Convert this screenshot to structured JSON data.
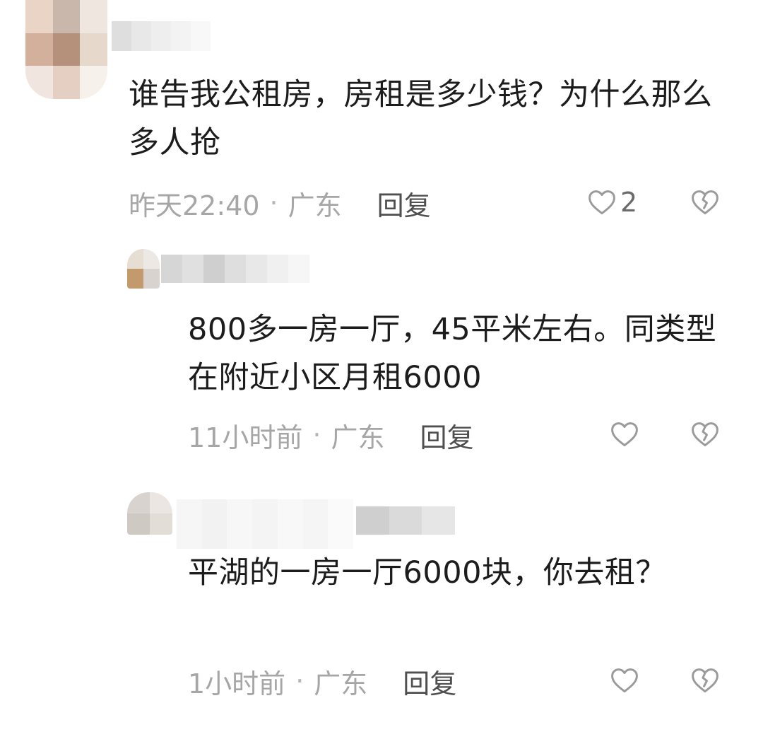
{
  "comment": {
    "text": "谁告我公租房，房租是多少钱？为什么那么多人抢",
    "time": "昨天22:40",
    "location": "广东",
    "separator": "·",
    "reply_label": "回复",
    "like_count": "2",
    "like_icon": "heart-outline-icon",
    "dislike_icon": "broken-heart-icon"
  },
  "replies": [
    {
      "text": "800多一房一厅，45平米左右。同类型在附近小区月租6000",
      "time": "11小时前",
      "location": "广东",
      "separator": "·",
      "reply_label": "回复",
      "like_icon": "heart-outline-icon",
      "dislike_icon": "broken-heart-icon"
    },
    {
      "text": "平湖的一房一厅6000块，你去租？",
      "time": "1小时前",
      "location": "广东",
      "separator": "·",
      "reply_label": "回复",
      "like_icon": "heart-outline-icon",
      "dislike_icon": "broken-heart-icon"
    }
  ],
  "colors": {
    "text": "#1c1c1c",
    "meta": "#a6a6a6",
    "reply": "#4f4f4f",
    "icon": "#9a9a9a"
  }
}
